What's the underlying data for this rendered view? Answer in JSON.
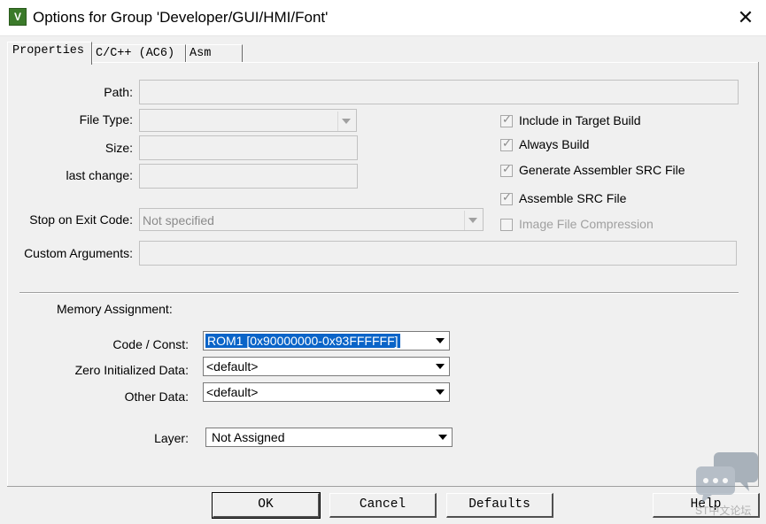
{
  "window": {
    "title": "Options for Group 'Developer/GUI/HMI/Font'",
    "icon": "keil-app-icon",
    "close_glyph": "✕"
  },
  "tabs": [
    {
      "label": "Properties",
      "active": true
    },
    {
      "label": "C/C++ (AC6)",
      "active": false
    },
    {
      "label": "Asm",
      "active": false
    }
  ],
  "properties": {
    "path_label": "Path:",
    "path_value": "",
    "file_type_label": "File Type:",
    "file_type_value": "",
    "size_label": "Size:",
    "size_value": "",
    "last_change_label": "last change:",
    "last_change_value": "",
    "stop_label": "Stop on Exit Code:",
    "stop_value": "Not specified",
    "custom_args_label": "Custom Arguments:",
    "custom_args_value": ""
  },
  "options": [
    {
      "label": "Include in Target Build",
      "checked": true,
      "enabled": true
    },
    {
      "label": "Always Build",
      "checked": true,
      "enabled": true
    },
    {
      "label": "Generate Assembler SRC File",
      "checked": true,
      "enabled": true
    },
    {
      "label": "Assemble SRC File",
      "checked": true,
      "enabled": true
    },
    {
      "label": "Image File Compression",
      "checked": false,
      "enabled": false
    }
  ],
  "memory": {
    "section_label": "Memory Assignment:",
    "code_label": "Code / Const:",
    "code_value": "ROM1 [0x90000000-0x93FFFFFF]",
    "zero_label": "Zero Initialized Data:",
    "zero_value": "<default>",
    "other_label": "Other Data:",
    "other_value": "<default>",
    "layer_label": "Layer:",
    "layer_value": "Not Assigned"
  },
  "buttons": {
    "ok": "OK",
    "cancel": "Cancel",
    "defaults": "Defaults",
    "help": "Help"
  },
  "watermark": {
    "text": "ST中文论坛"
  },
  "colors": {
    "selection": "#0a64c8",
    "dialog_bg": "#f0f0f0"
  }
}
